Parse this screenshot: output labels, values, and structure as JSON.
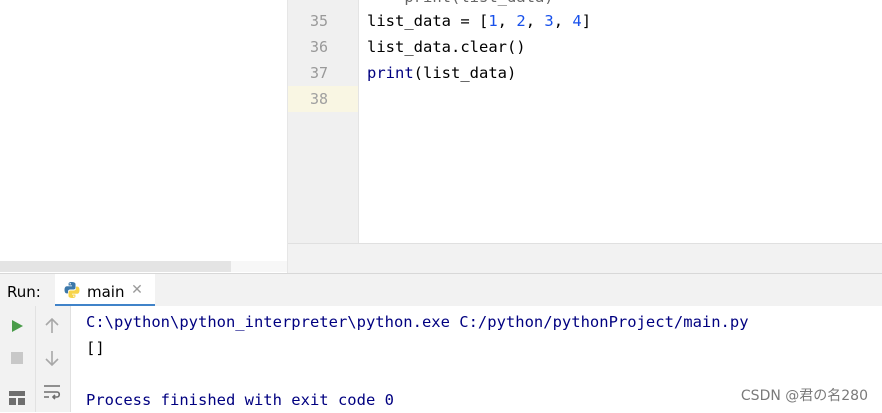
{
  "editor": {
    "partial_top_line": "    print(list_data)",
    "lines": [
      {
        "number": "35",
        "tokens": [
          {
            "t": "list_data = [",
            "c": "plain"
          },
          {
            "t": "1",
            "c": "num"
          },
          {
            "t": ", ",
            "c": "plain"
          },
          {
            "t": "2",
            "c": "num"
          },
          {
            "t": ", ",
            "c": "plain"
          },
          {
            "t": "3",
            "c": "num"
          },
          {
            "t": ", ",
            "c": "plain"
          },
          {
            "t": "4",
            "c": "num"
          },
          {
            "t": "]",
            "c": "plain"
          }
        ]
      },
      {
        "number": "36",
        "tokens": [
          {
            "t": "list_data.clear()",
            "c": "plain"
          }
        ]
      },
      {
        "number": "37",
        "tokens": [
          {
            "t": "print",
            "c": "builtin"
          },
          {
            "t": "(list_data)",
            "c": "plain"
          }
        ]
      },
      {
        "number": "38",
        "tokens": []
      }
    ]
  },
  "run": {
    "label": "Run:",
    "tab_label": "main",
    "tab_icon": "python-icon",
    "close_icon": "close-icon"
  },
  "toolbar": {
    "run_icon": "play-icon",
    "stop_icon": "stop-icon",
    "layout_icon": "layout-icon",
    "up_icon": "arrow-up-icon",
    "down_icon": "arrow-down-icon",
    "wrap_icon": "soft-wrap-icon"
  },
  "console": {
    "command": "C:\\python\\python_interpreter\\python.exe C:/python/pythonProject/main.py",
    "output": "[]",
    "blank": "",
    "exit_message": "Process finished with exit code 0"
  },
  "watermark": "CSDN @君の名280",
  "colors": {
    "accent_tab": "#4083c9",
    "number": "#1750eb",
    "builtin": "#000080",
    "console_text": "#000080",
    "run_green": "#4a9c4a"
  }
}
